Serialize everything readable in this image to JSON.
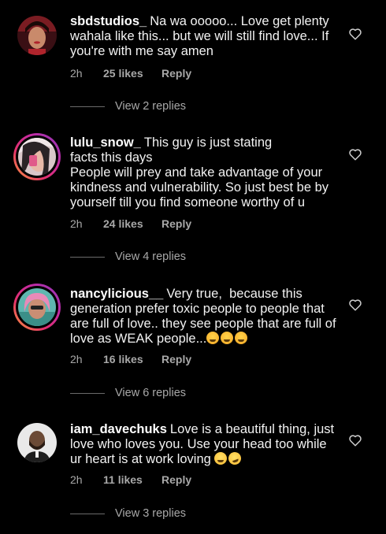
{
  "comments": [
    {
      "username": "sbdstudios_",
      "text": "Na wa ooooo... Love get plenty wahala like this... but we will still find love... If you're with me say amen",
      "time": "2h",
      "likes": "25 likes",
      "reply": "Reply",
      "view_replies": "View 2 replies",
      "avatar_icon": "avatar-woman-icon"
    },
    {
      "username": "lulu_snow_",
      "text_line1": "This guy is just stating",
      "text_rest": "facts this days\nPeople will prey and take advantage of your kindness and vulnerability. So just best be by yourself till you find someone worthy of u",
      "time": "2h",
      "likes": "24 likes",
      "reply": "Reply",
      "view_replies": "View 4 replies",
      "avatar_icon": "avatar-selfie-icon"
    },
    {
      "username": "nancylicious__",
      "text": "Very true,  because this generation prefer toxic people to people that are full of love.. they see people that are full of love as WEAK people...",
      "emojis": [
        "angry-face-emoji",
        "angry-face-emoji",
        "angry-face-emoji"
      ],
      "time": "2h",
      "likes": "16 likes",
      "reply": "Reply",
      "view_replies": "View 6 replies",
      "avatar_icon": "avatar-pink-hair-icon"
    },
    {
      "username": "iam_davechuks",
      "text": "Love is a beautiful thing, just love who loves you. Use your head too while ur heart is at work loving",
      "emojis": [
        "grinning-face-emoji",
        "rolling-laughing-emoji"
      ],
      "time": "2h",
      "likes": "11 likes",
      "reply": "Reply",
      "view_replies": "View 3 replies",
      "avatar_icon": "avatar-man-icon"
    }
  ],
  "colors": {
    "background": "#000000",
    "text": "#f2f2f2",
    "muted": "#a8a8a8",
    "story_ring": [
      "#f9a33a",
      "#e5316a",
      "#8a3ab9"
    ]
  },
  "icons": {
    "like": "heart-outline-icon"
  }
}
